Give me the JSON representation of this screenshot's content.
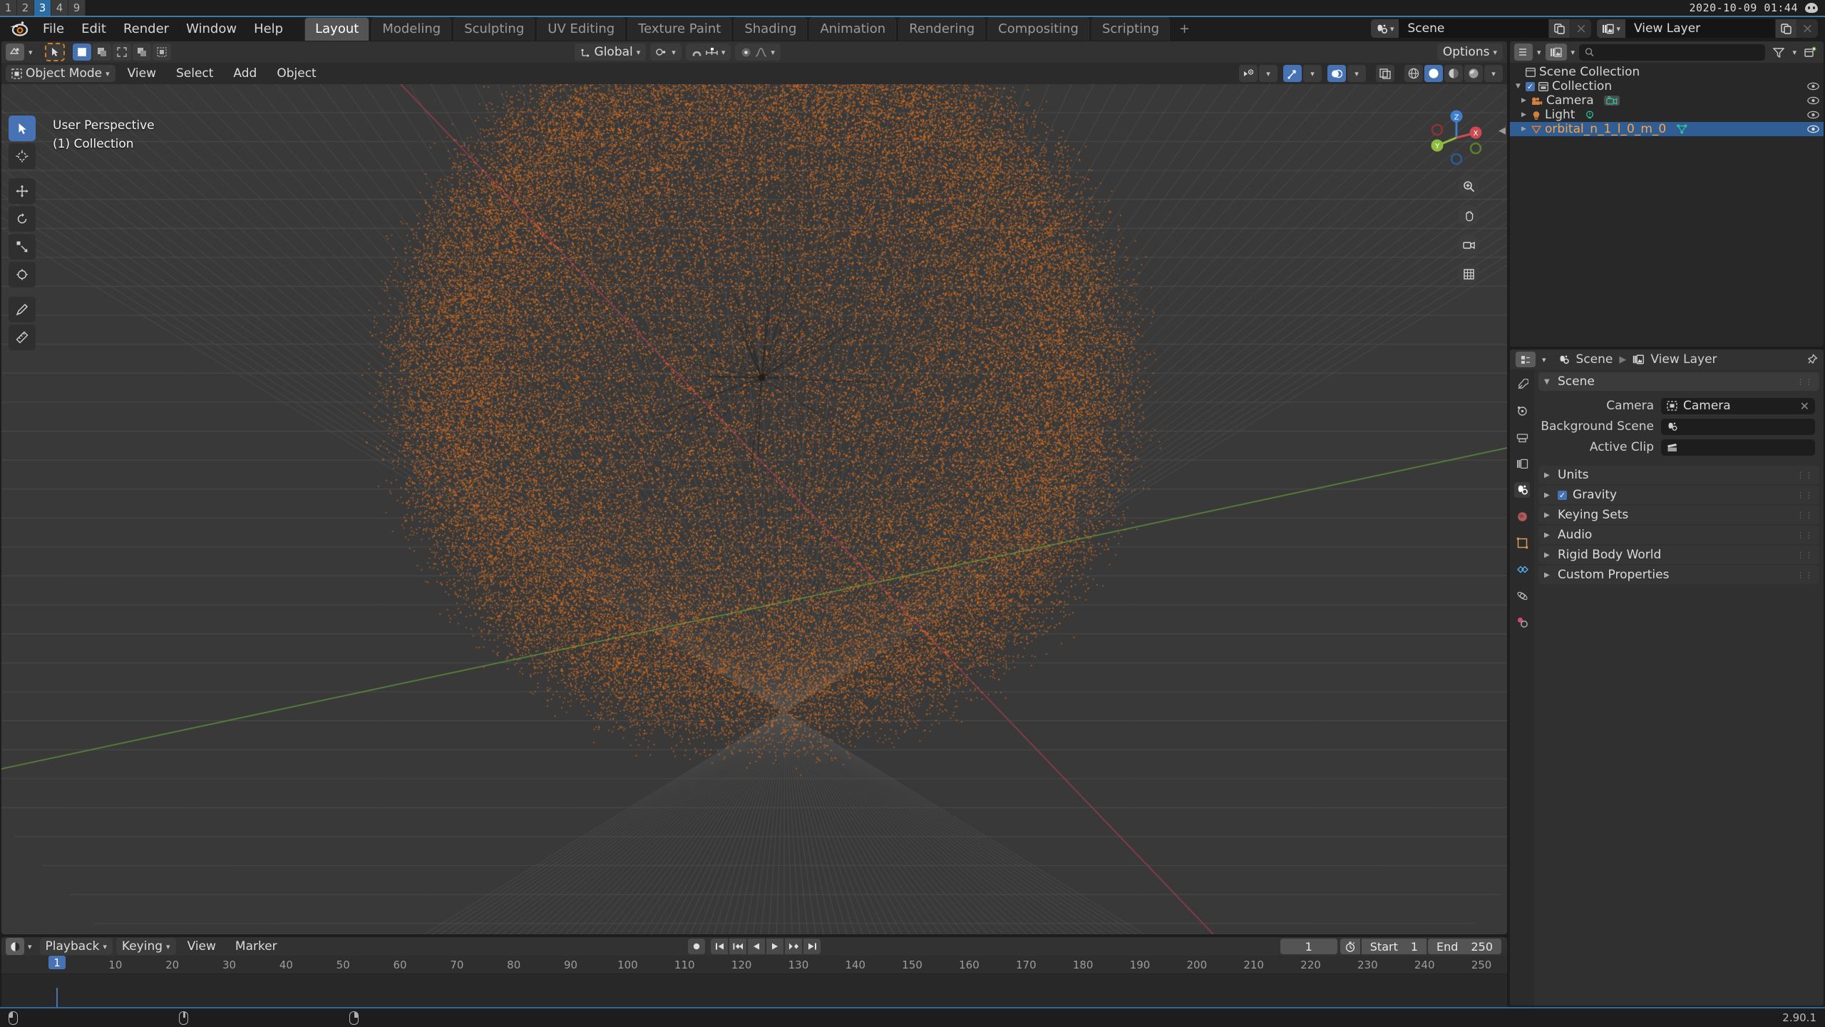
{
  "window": {
    "tabs": [
      {
        "label": "1",
        "active": false
      },
      {
        "label": "2",
        "active": false
      },
      {
        "label": "3",
        "active": true
      },
      {
        "label": "4",
        "active": false
      },
      {
        "label": "9",
        "active": false
      }
    ],
    "clock": "2020-10-09 01:44",
    "tray_icon": "discord-icon"
  },
  "topbar": {
    "logo": "blender-logo",
    "menus": [
      "File",
      "Edit",
      "Render",
      "Window",
      "Help"
    ],
    "workspaces": [
      {
        "label": "Layout",
        "active": true
      },
      {
        "label": "Modeling",
        "active": false
      },
      {
        "label": "Sculpting",
        "active": false
      },
      {
        "label": "UV Editing",
        "active": false
      },
      {
        "label": "Texture Paint",
        "active": false
      },
      {
        "label": "Shading",
        "active": false
      },
      {
        "label": "Animation",
        "active": false
      },
      {
        "label": "Rendering",
        "active": false
      },
      {
        "label": "Compositing",
        "active": false
      },
      {
        "label": "Scripting",
        "active": false
      }
    ],
    "add_workspace": "+",
    "scene_datablock": {
      "icon": "scene-icon",
      "name": "Scene",
      "new_btn": "new-scene-icon",
      "unlink_btn": "×"
    },
    "viewlayer_datablock": {
      "icon": "view-layer-icon",
      "name": "View Layer",
      "new_btn": "new-viewlayer-icon",
      "unlink_btn": "×"
    }
  },
  "viewport": {
    "header_top": {
      "editor_type": "editor-type-icon",
      "transform_orientation": "Global",
      "snap_icon": "snap-magnet-icon",
      "proportional_icon": "proportional-edit-icon",
      "options_label": "Options"
    },
    "header_bottom": {
      "mode": "Object Mode",
      "menus": [
        "View",
        "Select",
        "Add",
        "Object"
      ],
      "shading_modes": [
        "wireframe",
        "solid",
        "material-preview",
        "rendered"
      ],
      "active_shading": "solid"
    },
    "overlay_text": {
      "line1": "User Perspective",
      "line2": "(1) Collection"
    },
    "tools": [
      {
        "name": "tweak-tool",
        "active": true
      },
      {
        "name": "cursor-tool",
        "active": false
      },
      {
        "name": "move-tool",
        "active": false
      },
      {
        "name": "rotate-tool",
        "active": false
      },
      {
        "name": "scale-tool",
        "active": false
      },
      {
        "name": "transform-tool",
        "active": false
      },
      {
        "name": "annotate-tool",
        "active": false
      },
      {
        "name": "measure-tool",
        "active": false
      }
    ],
    "gizmo_axes": [
      {
        "label": "X",
        "color": "#cc4b52"
      },
      {
        "label": "Y",
        "color": "#8fbc3e"
      },
      {
        "label": "Z",
        "color": "#3f7ecc"
      }
    ],
    "nav_buttons": [
      "zoom-icon",
      "hand-pan-icon",
      "camera-view-icon",
      "toggle-ortho-icon"
    ],
    "object_color": "#e8741e",
    "background_color": "#393939",
    "grid_color": "#4b4b4b"
  },
  "outliner": {
    "display_mode_icon": "outliner-display-mode-icon",
    "search_placeholder": "",
    "search_icon": "search-icon",
    "filter_icon": "filter-icon",
    "new_collection_icon": "new-collection-icon",
    "rows": [
      {
        "label": "Scene Collection",
        "icon": "scene-collection-icon",
        "indent": 0,
        "selected": false,
        "has_eye": false,
        "has_tri": false,
        "has_check": false
      },
      {
        "label": "Collection",
        "icon": "collection-icon",
        "indent": 0,
        "selected": false,
        "has_eye": true,
        "has_tri": true,
        "has_check": true
      },
      {
        "label": "Camera",
        "icon": "camera-object-icon",
        "indent": 1,
        "selected": false,
        "has_eye": true,
        "has_tri": true,
        "has_check": false,
        "data_icon": "camera-data-icon"
      },
      {
        "label": "Light",
        "icon": "light-object-icon",
        "indent": 1,
        "selected": false,
        "has_eye": true,
        "has_tri": true,
        "has_check": false,
        "data_icon": "light-data-icon"
      },
      {
        "label": "orbital_n_1_l_0_m_0",
        "icon": "mesh-object-icon",
        "indent": 1,
        "selected": true,
        "has_eye": true,
        "has_tri": true,
        "has_check": false,
        "data_icon": "mesh-data-icon"
      }
    ]
  },
  "properties": {
    "breadcrumb": [
      {
        "label": "Scene",
        "icon": "scene-icon"
      },
      {
        "label": "View Layer",
        "icon": "view-layer-icon"
      }
    ],
    "pin_icon": "pin-icon",
    "tabs": [
      {
        "name": "tool-tab",
        "active": false
      },
      {
        "name": "render-tab",
        "active": false
      },
      {
        "name": "output-tab",
        "active": false
      },
      {
        "name": "view-layer-tab",
        "active": false
      },
      {
        "name": "scene-tab",
        "active": true
      },
      {
        "name": "world-tab",
        "active": false
      },
      {
        "name": "object-tab",
        "active": false
      },
      {
        "name": "modifier-tab",
        "active": false
      },
      {
        "name": "data-tab",
        "active": false
      },
      {
        "name": "material-tab",
        "active": false
      }
    ],
    "scene_panel": {
      "title": "Scene",
      "open": true,
      "fields": [
        {
          "label": "Camera",
          "value": "Camera",
          "icon": "camera-object-icon",
          "clearable": true
        },
        {
          "label": "Background Scene",
          "value": "",
          "icon": "scene-icon",
          "clearable": false
        },
        {
          "label": "Active Clip",
          "value": "",
          "icon": "clip-icon",
          "clearable": false
        }
      ]
    },
    "panels": [
      {
        "title": "Units",
        "open": false,
        "checkbox": null
      },
      {
        "title": "Gravity",
        "open": false,
        "checkbox": true
      },
      {
        "title": "Keying Sets",
        "open": false,
        "checkbox": null
      },
      {
        "title": "Audio",
        "open": false,
        "checkbox": null
      },
      {
        "title": "Rigid Body World",
        "open": false,
        "checkbox": null
      },
      {
        "title": "Custom Properties",
        "open": false,
        "checkbox": null
      }
    ]
  },
  "timeline": {
    "editor_icon": "timeline-editor-icon",
    "menus": [
      "Playback",
      "Keying",
      "View",
      "Marker"
    ],
    "transport": [
      "record-icon",
      "jump-start-icon",
      "prev-keyframe-icon",
      "play-reverse-icon",
      "play-icon",
      "next-keyframe-icon",
      "jump-end-icon"
    ],
    "current_frame": "1",
    "use_preview_range_icon": "stopwatch-icon",
    "start_label": "Start",
    "start_value": "1",
    "end_label": "End",
    "end_value": "250",
    "ruler_ticks": [
      "10",
      "20",
      "30",
      "40",
      "50",
      "60",
      "70",
      "80",
      "90",
      "100",
      "110",
      "120",
      "130",
      "140",
      "150",
      "160",
      "170",
      "180",
      "190",
      "200",
      "210",
      "220",
      "230",
      "240",
      "250"
    ],
    "playhead_frame": "1"
  },
  "statusbar": {
    "hints": [
      {
        "icon": "mouse-left-icon",
        "label": ""
      },
      {
        "icon": "mouse-middle-icon",
        "label": ""
      },
      {
        "icon": "mouse-right-icon",
        "label": ""
      }
    ],
    "version": "2.90.1"
  }
}
